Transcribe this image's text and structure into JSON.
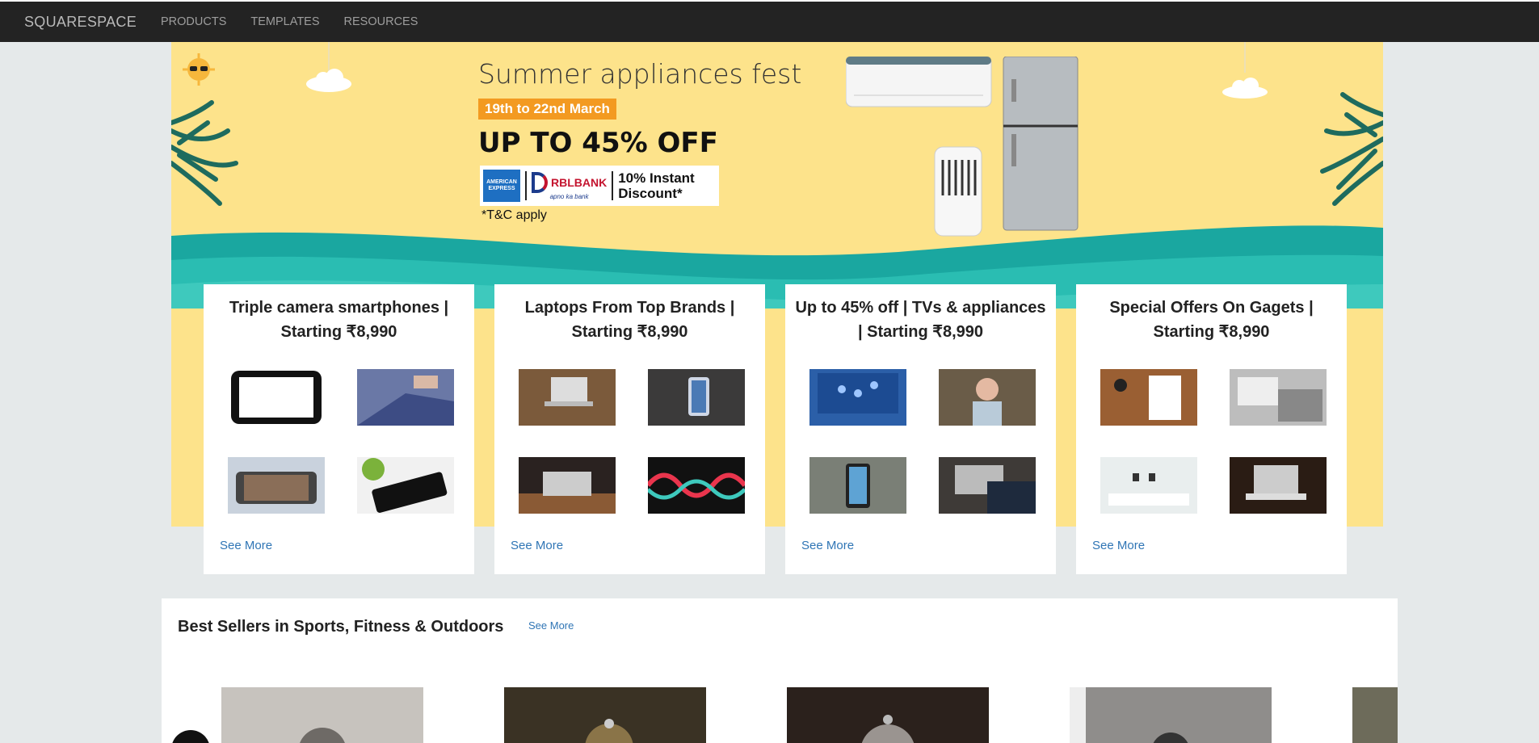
{
  "nav": {
    "brand": "SQUARESPACE",
    "links": [
      "PRODUCTS",
      "TEMPLATES",
      "RESOURCES"
    ]
  },
  "hero": {
    "title": "Summer appliances fest",
    "date": "19th to 22nd March",
    "discount": "UP TO 45% OFF",
    "bank_amex": "AMERICAN EXPRESS",
    "bank_rbl": "RBLBANK",
    "bank_rbl_tagline": "apno ka bank",
    "instant_discount_line1": "10% Instant",
    "instant_discount_line2": "Discount*",
    "tnc": "*T&C apply"
  },
  "cards": [
    {
      "title": "Triple camera smartphones | Starting ₹8,990",
      "see_more": "See More"
    },
    {
      "title": "Laptops From Top Brands | Starting ₹8,990",
      "see_more": "See More"
    },
    {
      "title": "Up to 45% off | TVs & appliances | Starting ₹8,990",
      "see_more": "See More"
    },
    {
      "title": "Special Offers On Gagets | Starting ₹8,990",
      "see_more": "See More"
    }
  ],
  "best_sellers": {
    "title": "Best Sellers in Sports, Fitness & Outdoors",
    "see_more": "See More"
  },
  "colors": {
    "nav_bg": "#232323",
    "hero_bg": "#fde38b",
    "wave_teal": "#1aa7a0",
    "link_blue": "#2f75b5",
    "badge_orange": "#f39a21"
  }
}
